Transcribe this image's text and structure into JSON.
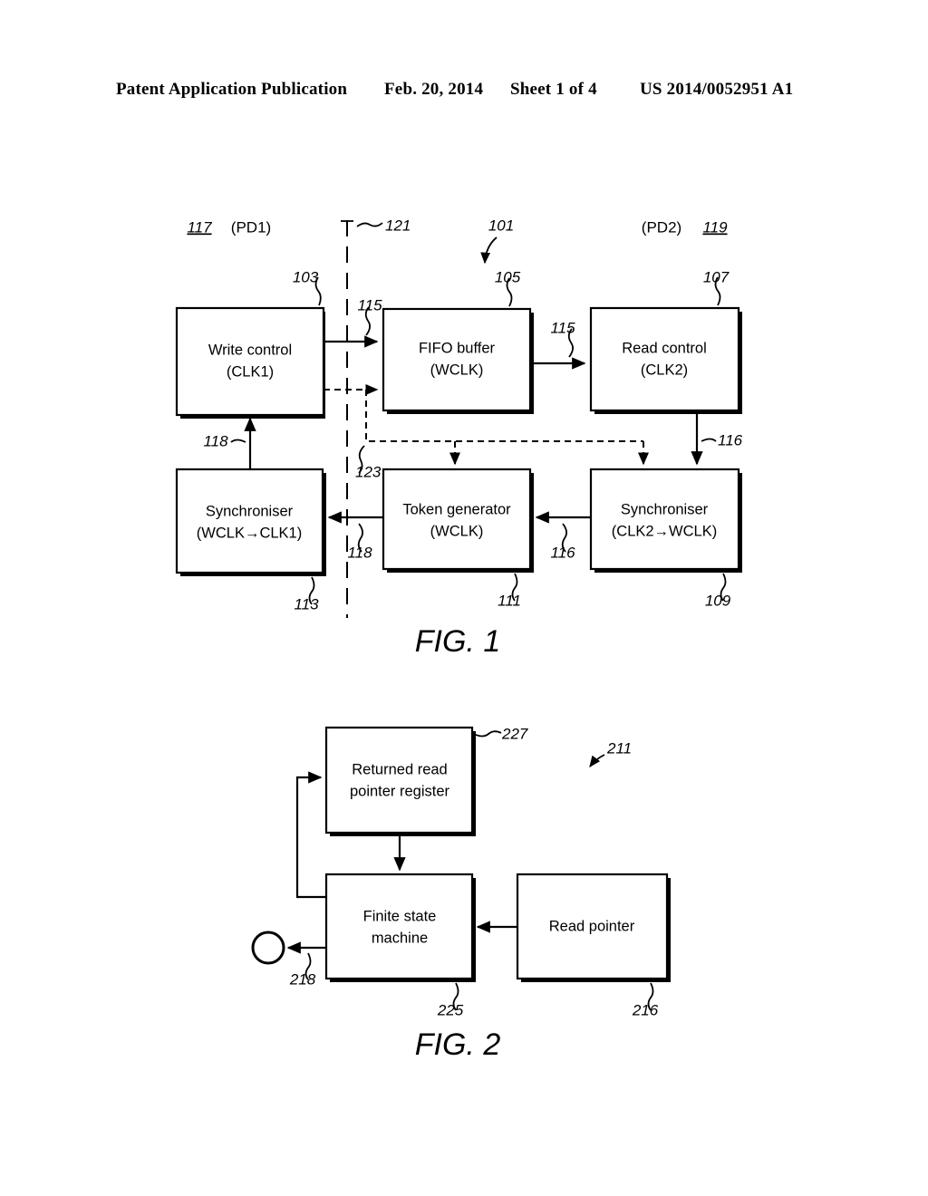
{
  "header": {
    "publication": "Patent Application Publication",
    "date": "Feb. 20, 2014",
    "sheet": "Sheet 1 of 4",
    "number": "US 2014/0052951 A1"
  },
  "figures": [
    {
      "caption": "FIG. 1",
      "domain_labels": [
        {
          "ref": "117",
          "text": "(PD1)"
        },
        {
          "ref": "119",
          "text": "(PD2)"
        }
      ],
      "boundary_ref": "121",
      "assembly_ref": "101",
      "boxes": [
        {
          "ref": "103",
          "line1": "Write control",
          "line2": "(CLK1)"
        },
        {
          "ref": "105",
          "line1": "FIFO buffer",
          "line2": "(WCLK)"
        },
        {
          "ref": "107",
          "line1": "Read control",
          "line2": "(CLK2)"
        },
        {
          "ref": "113",
          "line1": "Synchroniser",
          "line2": "(WCLK→CLK1)"
        },
        {
          "ref": "111",
          "line1": "Token generator",
          "line2": "(WCLK)"
        },
        {
          "ref": "109",
          "line1": "Synchroniser",
          "line2": "(CLK2→WCLK)"
        }
      ],
      "signal_refs": [
        "115",
        "115",
        "116",
        "116",
        "118",
        "118",
        "123"
      ]
    },
    {
      "caption": "FIG. 2",
      "assembly_ref": "211",
      "boxes": [
        {
          "ref": "227",
          "line1": "Returned read",
          "line2": "pointer register"
        },
        {
          "ref": "225",
          "line1": "Finite state",
          "line2": "machine"
        },
        {
          "ref": "216",
          "line1": "Read pointer",
          "line2": ""
        }
      ],
      "signal_refs": [
        "218"
      ]
    }
  ],
  "colors": {
    "ink": "#000000",
    "paper": "#ffffff"
  }
}
